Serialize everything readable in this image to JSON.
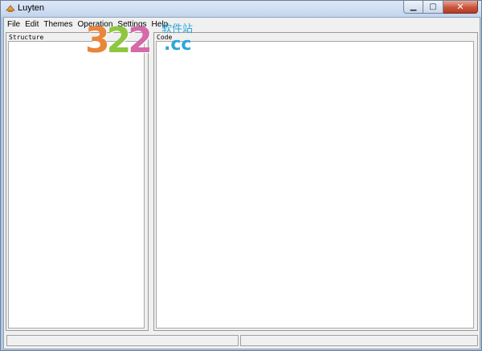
{
  "window": {
    "title": "Luyten",
    "minimize_glyph": "▁",
    "maximize_glyph": "▢",
    "close_glyph": "✕"
  },
  "menu": {
    "items": [
      {
        "label": "File"
      },
      {
        "label": "Edit"
      },
      {
        "label": "Themes"
      },
      {
        "label": "Operation"
      },
      {
        "label": "Settings"
      },
      {
        "label": "Help"
      }
    ]
  },
  "structure_panel": {
    "header": "Structure"
  },
  "code_panel": {
    "header": "Code"
  },
  "status": {
    "left": "",
    "right": ""
  },
  "watermark": {
    "digits": [
      "3",
      "2",
      "2"
    ],
    "cn_text": "软件站",
    "domain": ".cc"
  },
  "icons": {
    "app": "luyten-app-icon",
    "minimize": "minimize-icon",
    "maximize": "maximize-icon",
    "close": "close-icon"
  },
  "colors": {
    "titlebar": "#c8d9ee",
    "close_button": "#c9543c",
    "client_bg": "#f0f0f0",
    "watermark_blue": "#2aa7d8"
  }
}
